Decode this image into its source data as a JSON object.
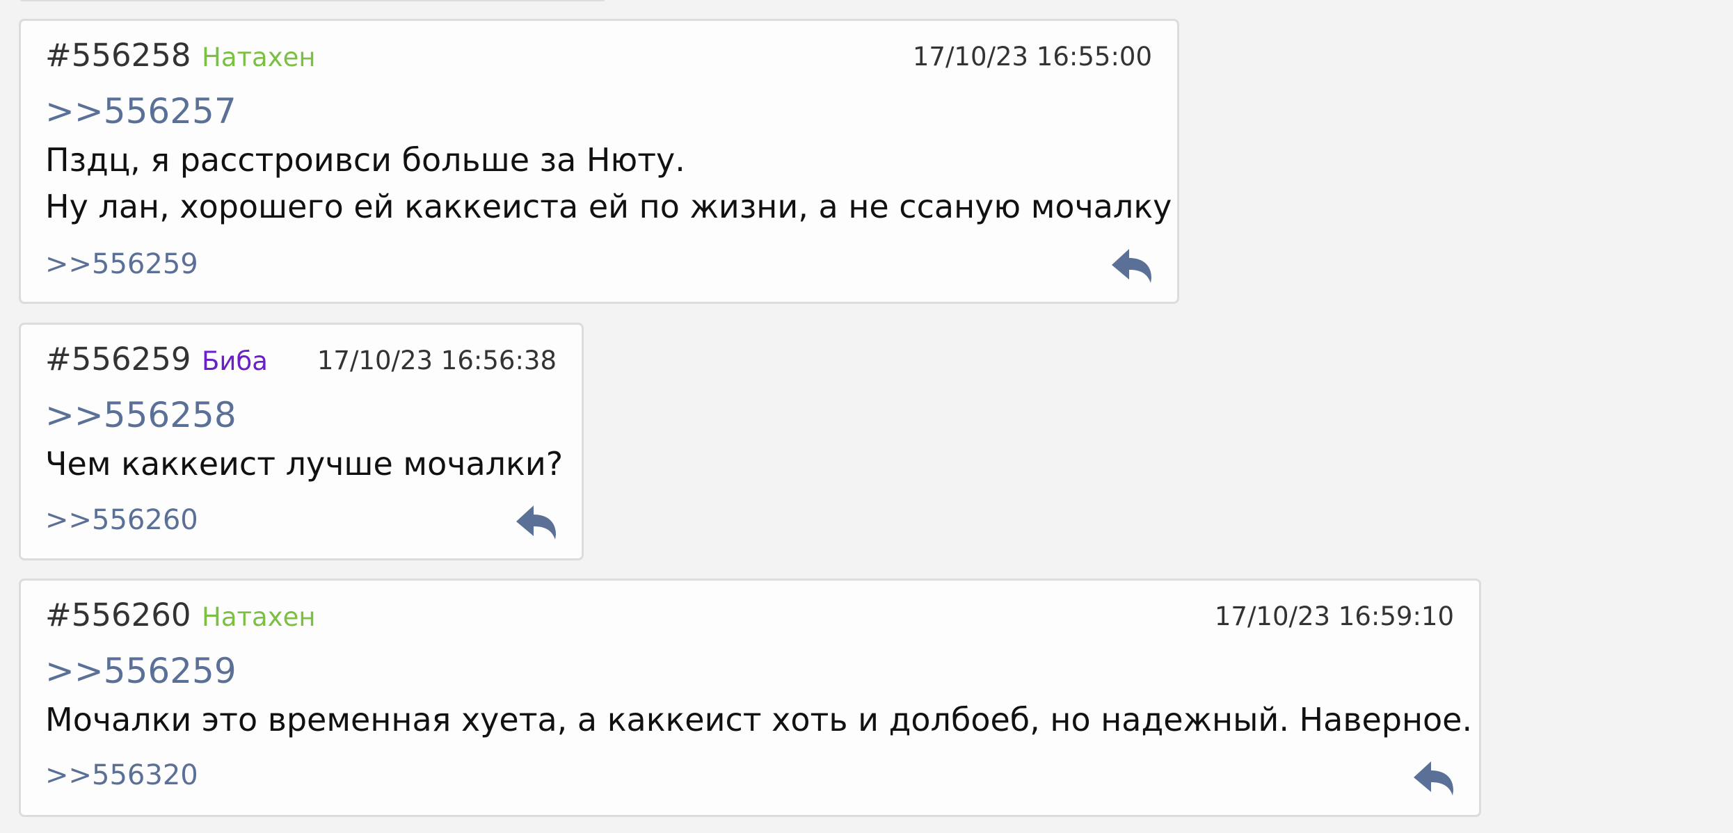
{
  "posts": [
    {
      "number": "#556258",
      "author": "Натахен",
      "author_color": "#7bc043",
      "date": "17/10/23 16:55:00",
      "quote": ">>556257",
      "lines": [
        "Пздц, я расстроивси больше за Нюту.",
        "Ну лан, хорошего ей каккеиста ей по жизни, а не ссаную мочалку"
      ],
      "reply": ">>556259",
      "reply_icon": "reply-arrow-icon"
    },
    {
      "number": "#556259",
      "author": "Биба",
      "author_color": "#6a1fc9",
      "date": "17/10/23 16:56:38",
      "quote": ">>556258",
      "lines": [
        "Чем каккеист лучше мочалки?"
      ],
      "reply": ">>556260",
      "reply_icon": "reply-arrow-icon"
    },
    {
      "number": "#556260",
      "author": "Натахен",
      "author_color": "#7bc043",
      "date": "17/10/23 16:59:10",
      "quote": ">>556259",
      "lines": [
        "Мочалки это временная хуета, а каккеист хоть и долбоеб, но надежный. Наверное."
      ],
      "reply": ">>556320",
      "reply_icon": "reply-arrow-icon"
    }
  ]
}
